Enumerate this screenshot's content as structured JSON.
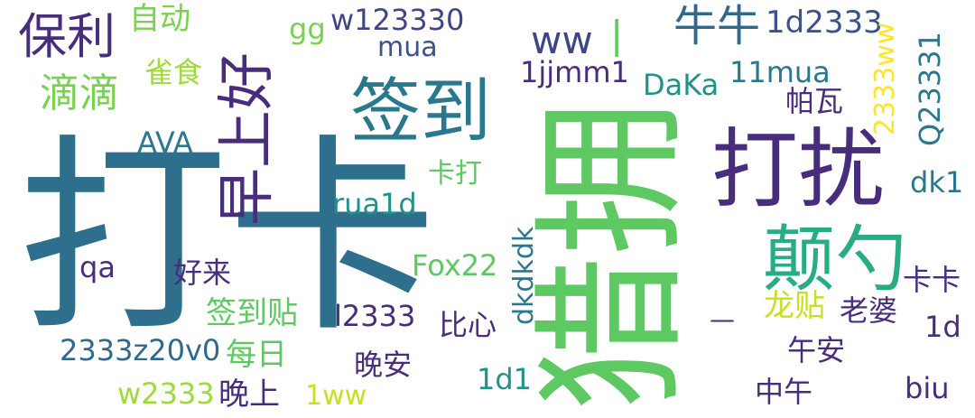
{
  "words": [
    {
      "text": "打卡",
      "color": "#2f6f8e"
    },
    {
      "text": "猎拥",
      "color": "#5ec962"
    },
    {
      "text": "打扰",
      "color": "#472d7b"
    },
    {
      "text": "签到",
      "color": "#2a788e"
    },
    {
      "text": "早上好",
      "color": "#472d7b"
    },
    {
      "text": "颠勺",
      "color": "#27ad81"
    },
    {
      "text": "保利",
      "color": "#472d7b"
    },
    {
      "text": "滴滴",
      "color": "#7ad151"
    },
    {
      "text": "牛牛",
      "color": "#31688e"
    },
    {
      "text": "1d2333",
      "color": "#3b528b"
    },
    {
      "text": "ww",
      "color": "#414487"
    },
    {
      "text": "|",
      "color": "#5ec962"
    },
    {
      "text": "自动",
      "color": "#7ad151"
    },
    {
      "text": "gg",
      "color": "#7ad151"
    },
    {
      "text": "w123330",
      "color": "#414487"
    },
    {
      "text": "mua",
      "color": "#3b528b"
    },
    {
      "text": "雀食",
      "color": "#a0da39"
    },
    {
      "text": "1jjmm1",
      "color": "#472d7b"
    },
    {
      "text": "DaKa",
      "color": "#21918c"
    },
    {
      "text": "11mua",
      "color": "#2a788e"
    },
    {
      "text": "2333ww",
      "color": "#fde725"
    },
    {
      "text": "Q23331",
      "color": "#2a788e"
    },
    {
      "text": "帕瓦",
      "color": "#472d7b"
    },
    {
      "text": "AVA",
      "color": "#2a788e"
    },
    {
      "text": "卡打",
      "color": "#5ec962"
    },
    {
      "text": "rua1d",
      "color": "#21918c"
    },
    {
      "text": "dk1",
      "color": "#2a788e"
    },
    {
      "text": "dkdkdk",
      "color": "#2a788e"
    },
    {
      "text": "qa",
      "color": "#472d7b"
    },
    {
      "text": "Fox22",
      "color": "#5ec962"
    },
    {
      "text": "好来",
      "color": "#472d7b"
    },
    {
      "text": "签到贴",
      "color": "#5ec962"
    },
    {
      "text": "l2333",
      "color": "#472d7b"
    },
    {
      "text": "比心",
      "color": "#472d7b"
    },
    {
      "text": "龙贴",
      "color": "#c8e020"
    },
    {
      "text": "老婆",
      "color": "#472d7b"
    },
    {
      "text": "卡卡",
      "color": "#472d7b"
    },
    {
      "text": "—",
      "color": "#472d7b"
    },
    {
      "text": "1d",
      "color": "#472d7b"
    },
    {
      "text": "2333z20v0",
      "color": "#31688e"
    },
    {
      "text": "每日",
      "color": "#5ec962"
    },
    {
      "text": "晚安",
      "color": "#472d7b"
    },
    {
      "text": "午安",
      "color": "#472d7b"
    },
    {
      "text": "1d1",
      "color": "#21918c"
    },
    {
      "text": "w2333",
      "color": "#a0da39"
    },
    {
      "text": "晚上",
      "color": "#472d7b"
    },
    {
      "text": "1ww",
      "color": "#c8e020"
    },
    {
      "text": "中午",
      "color": "#472d7b"
    },
    {
      "text": "biu",
      "color": "#472d7b"
    }
  ]
}
